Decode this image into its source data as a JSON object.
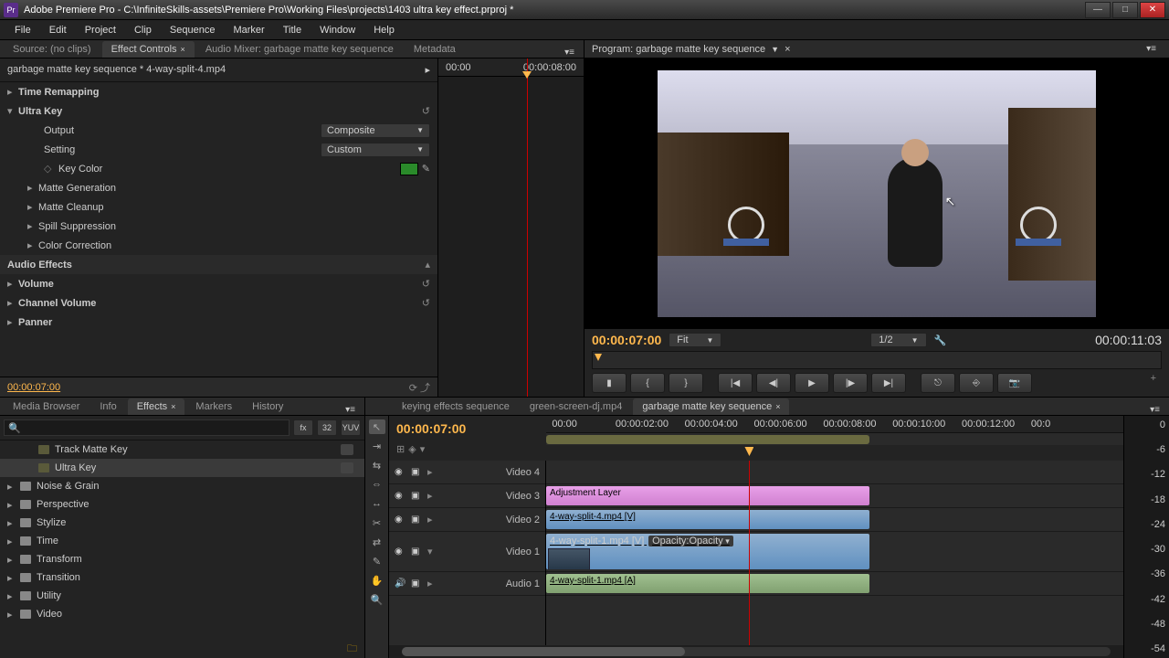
{
  "app": {
    "icon": "Pr",
    "title": "Adobe Premiere Pro - C:\\InfiniteSkills-assets\\Premiere Pro\\Working Files\\projects\\1403 ultra key effect.prproj *"
  },
  "menu": [
    "File",
    "Edit",
    "Project",
    "Clip",
    "Sequence",
    "Marker",
    "Title",
    "Window",
    "Help"
  ],
  "sourceTabs": {
    "source": "Source: (no clips)",
    "effectControls": "Effect Controls",
    "audioMixer": "Audio Mixer: garbage matte key sequence",
    "metadata": "Metadata"
  },
  "ec": {
    "header": "garbage matte key sequence * 4-way-split-4.mp4",
    "timeRemapping": "Time Remapping",
    "ultraKey": "Ultra Key",
    "output": "Output",
    "outputVal": "Composite",
    "setting": "Setting",
    "settingVal": "Custom",
    "keyColor": "Key Color",
    "keyColorSwatch": "#2a8a2a",
    "matteGen": "Matte Generation",
    "matteClean": "Matte Cleanup",
    "spill": "Spill Suppression",
    "colorCorr": "Color Correction",
    "audioEffects": "Audio Effects",
    "volume": "Volume",
    "channelVolume": "Channel Volume",
    "panner": "Panner",
    "ruler0": "00:00",
    "ruler1": "00:00:08:00",
    "footerTC": "00:00:07:00"
  },
  "program": {
    "title": "Program: garbage matte key sequence",
    "tcIn": "00:00:07:00",
    "fit": "Fit",
    "res": "1/2",
    "tcOut": "00:00:11:03"
  },
  "projectTabs": {
    "mediaBrowser": "Media Browser",
    "info": "Info",
    "effects": "Effects",
    "markers": "Markers",
    "history": "History"
  },
  "toolbtns": {
    "fx": "fx",
    "num": "32",
    "yuv": "YUV"
  },
  "fx": {
    "trackMatte": "Track Matte Key",
    "ultraKey": "Ultra Key",
    "noise": "Noise & Grain",
    "perspective": "Perspective",
    "stylize": "Stylize",
    "time": "Time",
    "transform": "Transform",
    "transition": "Transition",
    "utility": "Utility",
    "video": "Video"
  },
  "timeline": {
    "tabs": {
      "keying": "keying effects sequence",
      "green": "green-screen-dj.mp4",
      "garbage": "garbage matte key sequence"
    },
    "tc": "00:00:07:00",
    "ruler": [
      "00:00",
      "00:00:02:00",
      "00:00:04:00",
      "00:00:06:00",
      "00:00:08:00",
      "00:00:10:00",
      "00:00:12:00",
      "00:0"
    ],
    "tracks": {
      "v4": "Video 4",
      "v3": "Video 3",
      "v2": "Video 2",
      "v1": "Video 1",
      "a1": "Audio 1"
    },
    "clips": {
      "adj": "Adjustment Layer",
      "s4": "4-way-split-4.mp4 [V]",
      "s1": "4-way-split-1.mp4 [V]",
      "opacity": "Opacity:Opacity",
      "a1": "4-way-split-1.mp4 [A]"
    }
  },
  "meter": [
    "0",
    "-6",
    "-12",
    "-18",
    "-24",
    "-30",
    "-36",
    "-42",
    "-48",
    "-54"
  ]
}
